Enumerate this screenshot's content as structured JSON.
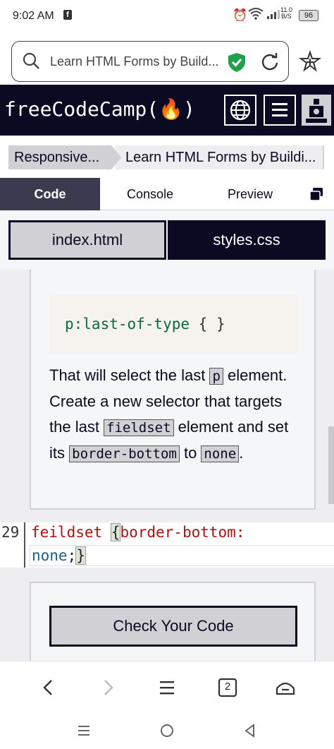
{
  "status_bar": {
    "time": "9:02 AM",
    "fb_icon": "f",
    "net_speed_top": "11.0",
    "net_speed_bottom": "B/S",
    "battery": "96"
  },
  "url_bar": {
    "url_text": "Learn HTML Forms by Build..."
  },
  "fcc_nav": {
    "brand": "freeCodeCamp(🔥)"
  },
  "breadcrumb": {
    "section": "Responsive...",
    "lesson": "Learn HTML Forms by Buildi..."
  },
  "tabs": {
    "code": "Code",
    "console": "Console",
    "preview": "Preview"
  },
  "file_tabs": {
    "index": "index.html",
    "styles": "styles.css"
  },
  "instructions": {
    "code_selector": "p:last-of-type",
    "code_braces": "{ }",
    "desc": {
      "t1": "That will select the last ",
      "k1": "p",
      "t2": " element. Create a new selector that targets the last ",
      "k2": "fieldset",
      "t3": " element and set its ",
      "k3": "border-bottom",
      "t4": " to ",
      "k4": "none",
      "t5": "."
    }
  },
  "editor": {
    "line_number": "29",
    "selector": "feildset ",
    "brace_open": "{",
    "property": "border-bottom:",
    "value": "none",
    "semicolon": ";",
    "brace_close": "}"
  },
  "check_button": {
    "label": "Check Your Code"
  },
  "browser_nav": {
    "tab_count": "2"
  },
  "colors": {
    "fcc_dark": "#0a0a23",
    "tab_active": "#3b3b4f",
    "secondary_bg": "#d0d0d5",
    "shield_green": "#1fa04a"
  }
}
